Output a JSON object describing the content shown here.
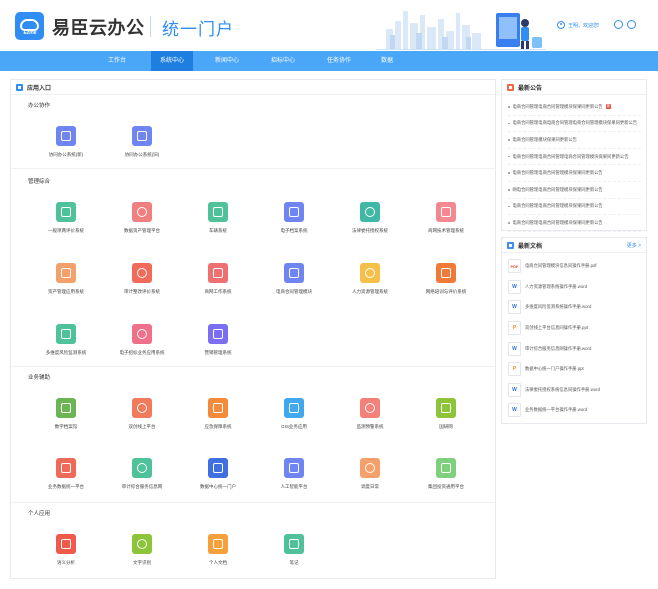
{
  "header": {
    "logo_text": "Ezine",
    "brand": "易臣云办公",
    "portal": "统一门户",
    "greeting": "王明，欢迎您!"
  },
  "nav": {
    "items": [
      {
        "label": "工作台",
        "active": false
      },
      {
        "label": "系统中心",
        "active": true
      },
      {
        "label": "新闻中心",
        "active": false
      },
      {
        "label": "招标中心",
        "active": false
      },
      {
        "label": "任务协作",
        "active": false
      },
      {
        "label": "数据",
        "active": false
      }
    ]
  },
  "apps_panel": {
    "title": "应用入口",
    "sections": [
      {
        "title": "办公协作",
        "apps": [
          {
            "label": "协同办公系统(新)",
            "color": "#6f86f2"
          },
          {
            "label": "协同办公系统(旧)",
            "color": "#6f86f2"
          }
        ]
      },
      {
        "title": "管理综合",
        "apps": [
          {
            "label": "一般项两评价系统",
            "color": "#4fc29a"
          },
          {
            "label": "数据资产管理平台",
            "color": "#f08080"
          },
          {
            "label": "车辆系统",
            "color": "#4fc29a"
          },
          {
            "label": "电子档案系统",
            "color": "#6f86f2"
          },
          {
            "label": "法律委托授权系统",
            "color": "#40b8a5"
          },
          {
            "label": "商网技术管理系统",
            "color": "#f4878f"
          },
          {
            "label": "资产管理应用系统",
            "color": "#f5a06b"
          },
          {
            "label": "审计整改评价系统",
            "color": "#f06b5a"
          },
          {
            "label": "商网工作系统",
            "color": "#ee7070"
          },
          {
            "label": "电商合同管理模块",
            "color": "#6f86f2"
          },
          {
            "label": "人力资源管理系统",
            "color": "#f5c04a"
          },
          {
            "label": "网络培训与评价系统",
            "color": "#f07a3a"
          },
          {
            "label": "多维度风险监测系统",
            "color": "#4fc29a"
          },
          {
            "label": "电子招标业务应用系统",
            "color": "#f0708a"
          },
          {
            "label": "营销管理系统",
            "color": "#7a6ef2"
          }
        ]
      },
      {
        "title": "业务辅助",
        "apps": [
          {
            "label": "数字档案馆",
            "color": "#6cb554"
          },
          {
            "label": "双创线上平台",
            "color": "#f07a5a"
          },
          {
            "label": "应急保障系统",
            "color": "#f58a3a"
          },
          {
            "label": "GIS业务应用",
            "color": "#40a8ee"
          },
          {
            "label": "监测预警系统",
            "color": "#f4807a"
          },
          {
            "label": "国研网",
            "color": "#8cc43a"
          },
          {
            "label": "业务数据统一平台",
            "color": "#f06a5a"
          },
          {
            "label": "审计综合服务信息网",
            "color": "#4fc29a"
          },
          {
            "label": "数据中心统一门户",
            "color": "#3f6fe0"
          },
          {
            "label": "人工智能平台",
            "color": "#6f86f2"
          },
          {
            "label": "调度日常",
            "color": "#f5a06b"
          },
          {
            "label": "集团投资通用平台",
            "color": "#7fd07a"
          }
        ]
      },
      {
        "title": "个人应用",
        "apps": [
          {
            "label": "语义分析",
            "color": "#f05a4a"
          },
          {
            "label": "文字识别",
            "color": "#8cc43a"
          },
          {
            "label": "个人文档",
            "color": "#f5a03a"
          },
          {
            "label": "笔记",
            "color": "#4fc29a"
          }
        ]
      }
    ]
  },
  "notice_panel": {
    "title": "最新公告",
    "items": [
      {
        "text": "电商合同管理电商合同管理模块保果同更新公告",
        "is_new": true,
        "new_label": "新"
      },
      {
        "text": "电商合同管理电商电商合同管理电商合同管理模块保果同更新公告",
        "is_new": false
      },
      {
        "text": "电商合同管理模块保果同更新公告",
        "is_new": false
      },
      {
        "text": "电商合同管理电商合同管理电商合同管理模块保果同更新公告",
        "is_new": false
      },
      {
        "text": "电商合同管理电商合同管理模块保果同更新公告",
        "is_new": false
      },
      {
        "text": "网电合同管理电商合同管理模块保果同更新公告",
        "is_new": false
      },
      {
        "text": "电商合同管理电商合同管理模块保果同更新公告",
        "is_new": false
      },
      {
        "text": "电商合同管理电商合同管理模块保果同更新公告",
        "is_new": false
      }
    ]
  },
  "doc_panel": {
    "title": "最新文档",
    "more_label": "更多 >",
    "items": [
      {
        "type": "PDF",
        "kind": "pdf",
        "name": "电商合同管理模块信息同操作手册.pdf"
      },
      {
        "type": "W",
        "kind": "word",
        "name": "人力资源管理系统操作手册.word"
      },
      {
        "type": "W",
        "kind": "word",
        "name": "多维度风险监测系统操作手册.word"
      },
      {
        "type": "P",
        "kind": "ppt",
        "name": "双创线上平台信息同操作手册.ppt"
      },
      {
        "type": "W",
        "kind": "word",
        "name": "审计综合服务信息网操作手册.word"
      },
      {
        "type": "P",
        "kind": "ppt",
        "name": "数据中心统一门户操作手册.ppt"
      },
      {
        "type": "W",
        "kind": "word",
        "name": "法律委托授权系统信息同操作手册.word"
      },
      {
        "type": "W",
        "kind": "word",
        "name": "业务数据统一平台操作手册.word"
      }
    ]
  }
}
